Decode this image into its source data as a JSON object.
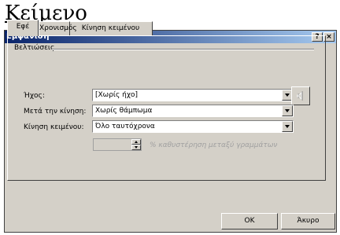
{
  "document": {
    "heading": "Κείμενο"
  },
  "dialog": {
    "title": "Εμφάνιση",
    "help_label": "?",
    "close_label": "×",
    "tabs": [
      {
        "label": "Εφέ",
        "active": true
      },
      {
        "label": "Χρονισμός",
        "active": false
      },
      {
        "label": "Κίνηση κειμένου",
        "active": false
      }
    ],
    "group_title": "Βελτιώσεις",
    "fields": {
      "sound": {
        "label": "Ήχος:",
        "value": "[Χωρίς ήχο]"
      },
      "after_animation": {
        "label": "Μετά την κίνηση:",
        "value": "Χωρίς θάμπωμα"
      },
      "animate_text": {
        "label": "Κίνηση κειμένου:",
        "value": "Όλο ταυτόχρονα"
      }
    },
    "delay": {
      "value": "",
      "label": "% καθυστέρηση μεταξύ γραμμάτων",
      "disabled": true
    },
    "buttons": {
      "ok": "OK",
      "cancel": "Άκυρο"
    }
  },
  "icons": {
    "sound": "speaker-icon"
  },
  "colors": {
    "titlebar_start": "#0a246a",
    "titlebar_end": "#a6caf0",
    "face": "#d4d0c8"
  }
}
